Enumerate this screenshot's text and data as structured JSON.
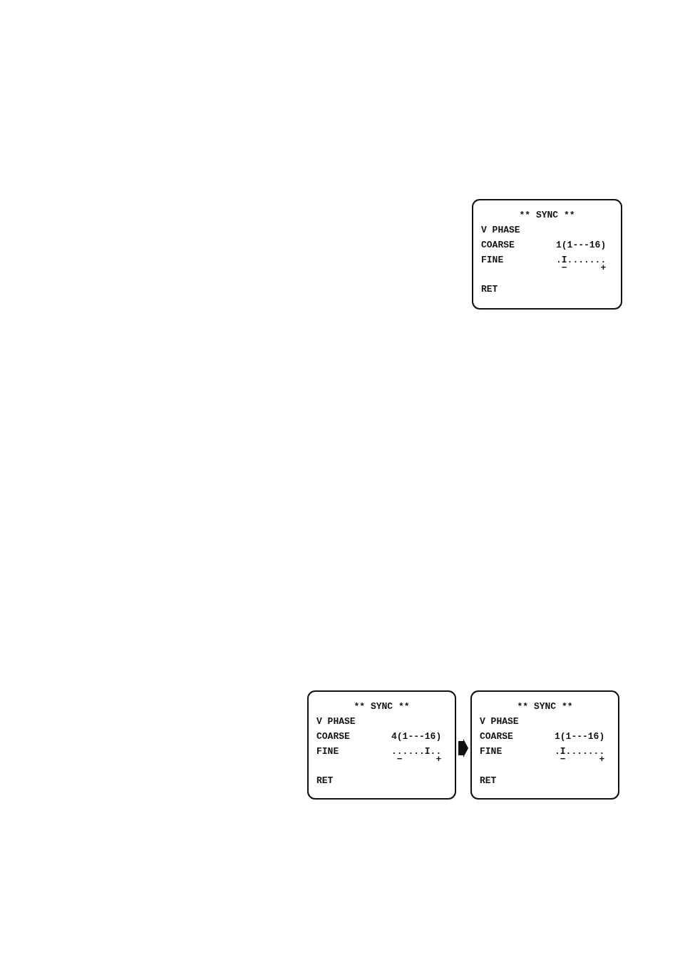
{
  "top_screen": {
    "title": "** SYNC **",
    "rows": [
      {
        "kind": "heading",
        "label": "V PHASE"
      },
      {
        "kind": "value",
        "label": "COARSE",
        "value": "1(1---16)"
      },
      {
        "kind": "scale",
        "label": "FINE",
        "scale": ".I.......",
        "minus": "−",
        "plus": "+"
      },
      {
        "kind": "action",
        "label": "RET"
      }
    ]
  },
  "before_after": {
    "before": {
      "title": "** SYNC **",
      "rows": [
        {
          "kind": "heading",
          "label": "V PHASE"
        },
        {
          "kind": "value",
          "label": "COARSE",
          "value": "4(1---16)"
        },
        {
          "kind": "scale",
          "label": "FINE",
          "scale": "......I..",
          "minus": "−",
          "plus": "+"
        },
        {
          "kind": "action",
          "label": "RET"
        }
      ]
    },
    "after": {
      "title": "** SYNC **",
      "rows": [
        {
          "kind": "heading",
          "label": "V PHASE"
        },
        {
          "kind": "value",
          "label": "COARSE",
          "value": "1(1---16)"
        },
        {
          "kind": "scale",
          "label": "FINE",
          "scale": ".I.......",
          "minus": "−",
          "plus": "+"
        },
        {
          "kind": "action",
          "label": "RET"
        }
      ]
    }
  }
}
